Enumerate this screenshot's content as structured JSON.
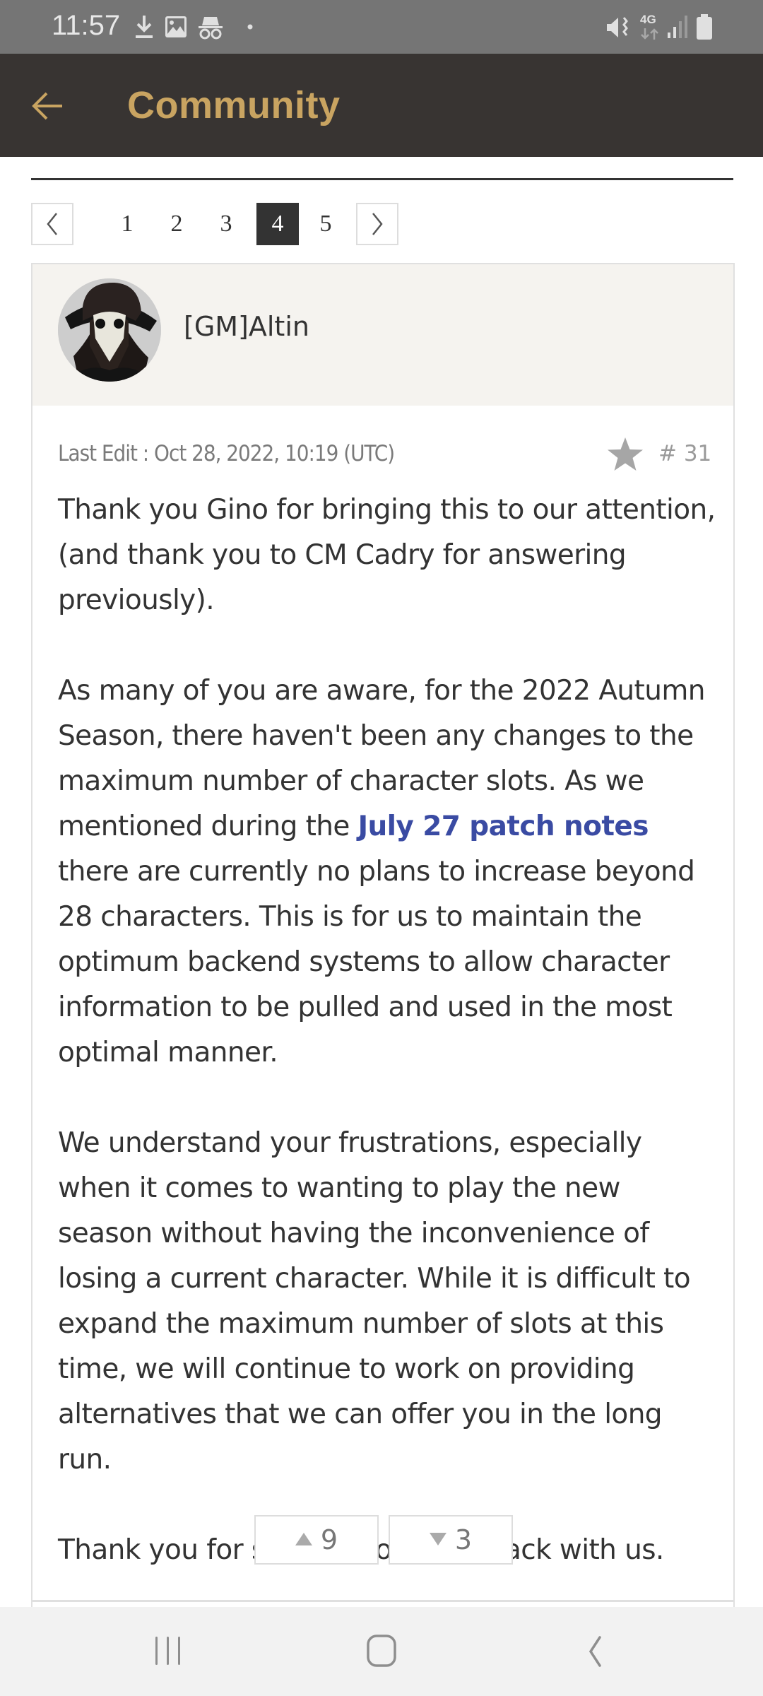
{
  "status_bar": {
    "time": "11:57",
    "left_icons": [
      "download-icon",
      "image-icon",
      "incognito-icon",
      "dot-icon"
    ],
    "right_icons": [
      "mute-vibrate-icon",
      "network-4g-icon",
      "signal-icon",
      "battery-icon"
    ],
    "network_label": "4G"
  },
  "app_bar": {
    "title": "Community",
    "back_icon": "arrow-left-icon",
    "title_color": "#c9a461",
    "background": "#383432"
  },
  "pagination": {
    "prev_icon": "chevron-left-icon",
    "next_icon": "chevron-right-icon",
    "pages": [
      "1",
      "2",
      "3",
      "4",
      "5"
    ],
    "current_page": "4"
  },
  "post": {
    "author": "[GM]Altin",
    "avatar": "plague-doctor-avatar",
    "last_edit": "Last Edit : Oct 28, 2022, 10:19 (UTC)",
    "post_number": "# 31",
    "bookmark_icon": "star-icon",
    "paragraphs": {
      "p1": "Thank you Gino for bringing this to our attention, (and thank you to CM Cadry for answering previously).",
      "p2_before": "As many of you are aware, for the 2022 Autumn Season, there haven't been any changes to the maximum number of character slots. As we mentioned during the ",
      "p2_link": "July 27 patch notes",
      "p2_after": " there are currently no plans to increase beyond 28 characters. This is for us to maintain the optimum backend systems to allow character information to be pulled and used in the most optimal manner.",
      "p3": "We understand your frustrations, especially when it comes to wanting to play the new season without having the inconvenience of losing a current character. While it is difficult to expand the maximum number of slots at this time, we will continue to work on providing alternatives that we can offer you in the long run.",
      "p4": "Thank you for sharing your feedback with us."
    },
    "link_color": "#3a4ba3",
    "upvotes": "9",
    "downvotes": "3"
  },
  "nav_bar": {
    "buttons": [
      "recent-apps-icon",
      "home-icon",
      "back-icon"
    ]
  }
}
